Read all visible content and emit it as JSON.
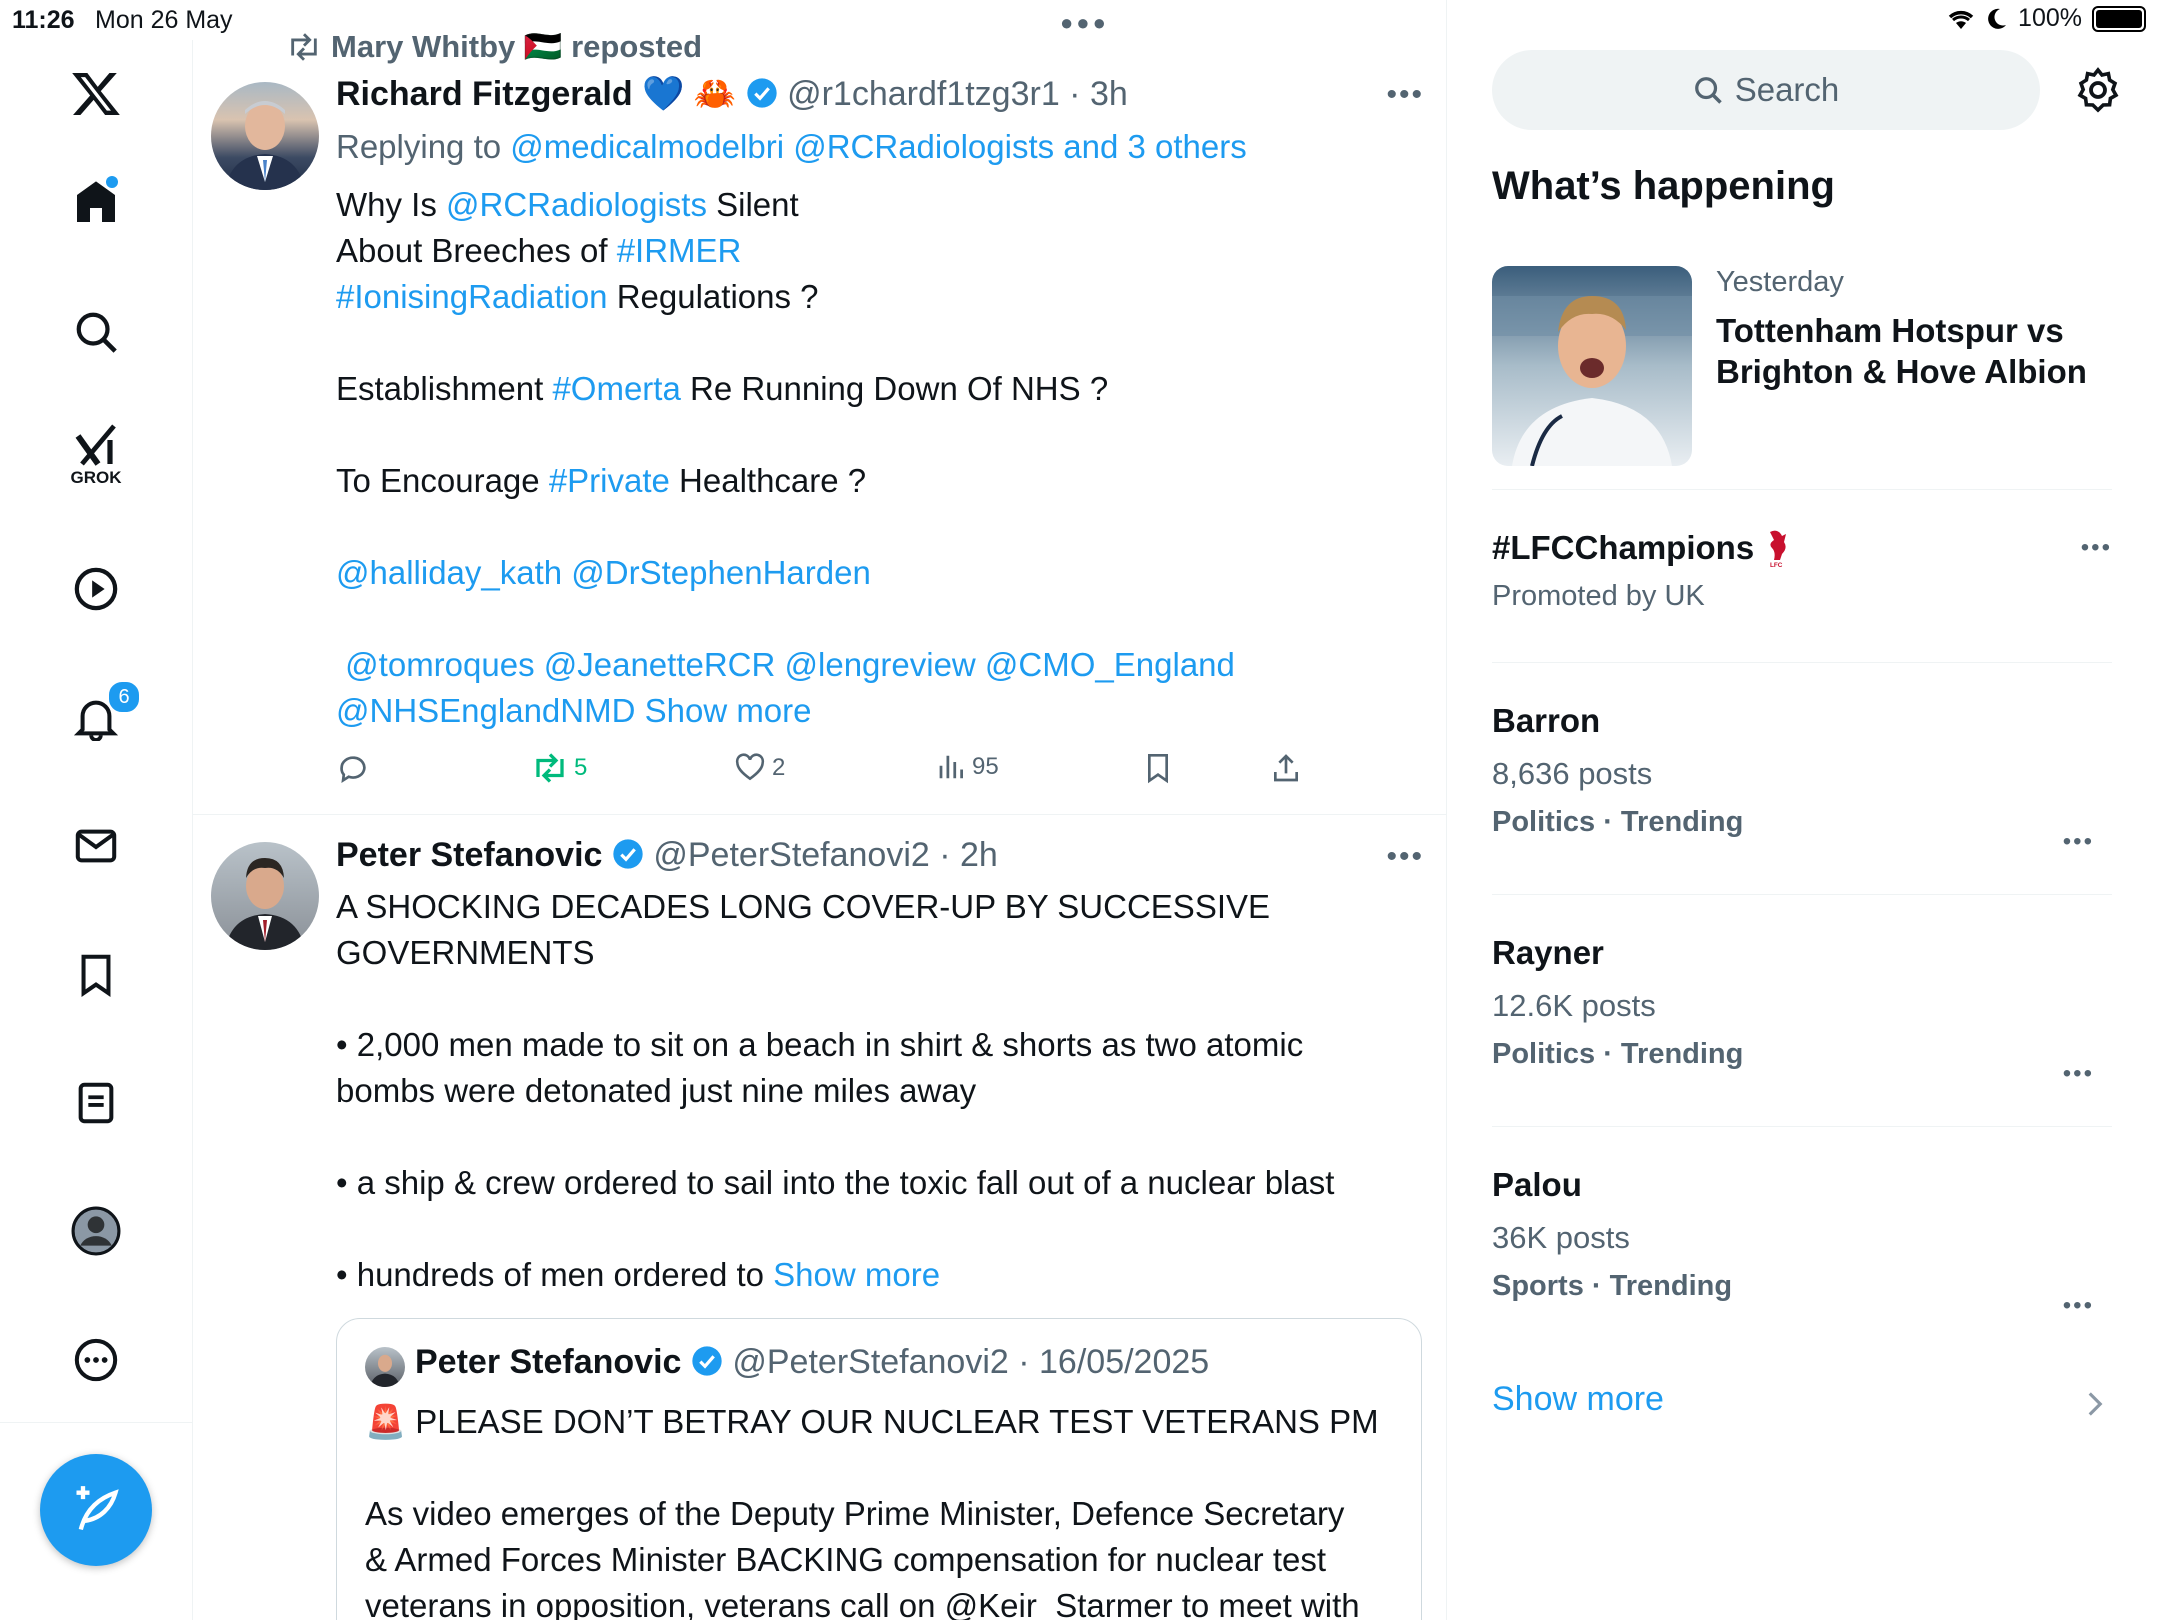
{
  "status_bar": {
    "time": "11:26",
    "date": "Mon 26 May",
    "battery": "100%"
  },
  "nav": {
    "logo": "x-logo-icon",
    "items": [
      "home-icon",
      "search-icon",
      "grok-icon",
      "video-icon",
      "notifications-icon",
      "messages-icon",
      "bookmarks-icon",
      "lists-icon",
      "profile-icon",
      "more-icon"
    ],
    "grok_label": "GROK",
    "notification_count": "6",
    "compose": "compose-icon"
  },
  "feed": {
    "post1": {
      "repost_by": "Mary Whitby 🇵🇸 reposted",
      "name": "Richard Fitzgerald 💙 🦀",
      "handle": "@r1chardf1tzg3r1 · 3h",
      "reply_prefix": "Replying to ",
      "reply_to": "@medicalmodelbri @RCRadiologists and 3 others",
      "text": {
        "l1a": "Why Is ",
        "l1b": "@RCRadiologists",
        "l1c": " Silent",
        "l2a": "About Breeches of ",
        "l2b": "#IRMER",
        "l3a": "#IonisingRadiation",
        "l3b": " Regulations ?",
        "l4a": "Establishment ",
        "l4b": "#Omerta",
        "l4c": " Re Running Down Of NHS ?",
        "l5a": "To Encourage ",
        "l5b": "#Private",
        "l5c": " Healthcare ?",
        "l6": "@halliday_kath @DrStephenHarden",
        "l7": " @tomroques @JeanetteRCR @lengreview @CMO_England",
        "l8": "@NHSEnglandNMD Show more"
      },
      "reposts": "5",
      "likes": "2",
      "views": "95"
    },
    "post2": {
      "name": "Peter Stefanovic",
      "handle": "@PeterStefanovi2 · 2h",
      "line1": "A SHOCKING DECADES LONG COVER-UP BY SUCCESSIVE",
      "line2": "GOVERNMENTS",
      "b1a": "• 2,000 men made to sit on a beach in shirt & shorts as two atomic",
      "b1b": "bombs were detonated just nine miles away",
      "b2": "• a ship & crew ordered to sail into the toxic fall out of a nuclear blast",
      "b3": "• hundreds of men ordered to ",
      "show_more": "Show more",
      "quote": {
        "name": "Peter Stefanovic",
        "handle": "@PeterStefanovi2 · 16/05/2025",
        "line1": "🚨 PLEASE DON’T BETRAY OUR NUCLEAR TEST VETERANS PM",
        "line2": "As video emerges of the Deputy Prime Minister, Defence Secretary",
        "line3": "& Armed Forces Minister BACKING compensation for nuclear test",
        "line4": "veterans in opposition, veterans call on @Keir_Starmer to meet with"
      }
    }
  },
  "sidebar": {
    "search_placeholder": "Search",
    "heading": "What’s happening",
    "featured": {
      "when": "Yesterday",
      "title1": "Tottenham Hotspur vs",
      "title2": "Brighton & Hove Albion"
    },
    "promoted": {
      "tag": "#LFCChampions",
      "by": "Promoted by UK"
    },
    "trends": [
      {
        "name": "Barron",
        "posts": "8,636 posts",
        "category": "Politics · Trending"
      },
      {
        "name": "Rayner",
        "posts": "12.6K posts",
        "category": "Politics · Trending"
      },
      {
        "name": "Palou",
        "posts": "36K posts",
        "category": "Sports · Trending"
      }
    ],
    "show_more": "Show more"
  }
}
